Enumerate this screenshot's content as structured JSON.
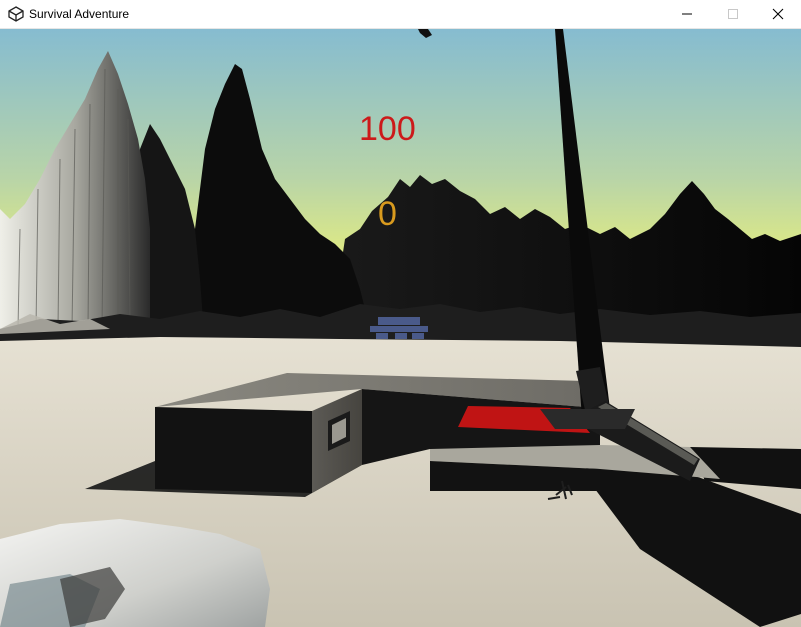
{
  "window": {
    "title": "Survival Adventure",
    "app_icon": "unity-icon",
    "controls": [
      "minimize-icon",
      "maximize-icon",
      "close-icon"
    ]
  },
  "hud": {
    "health": "100",
    "health_color": "#cc1a1a",
    "counter": "0",
    "counter_color": "#d89a1e"
  },
  "colors": {
    "sky_top": "#86bcd0",
    "sky_horizon": "#e9f07a",
    "ground": "#d9d4c5",
    "accent_red": "#c01414"
  }
}
